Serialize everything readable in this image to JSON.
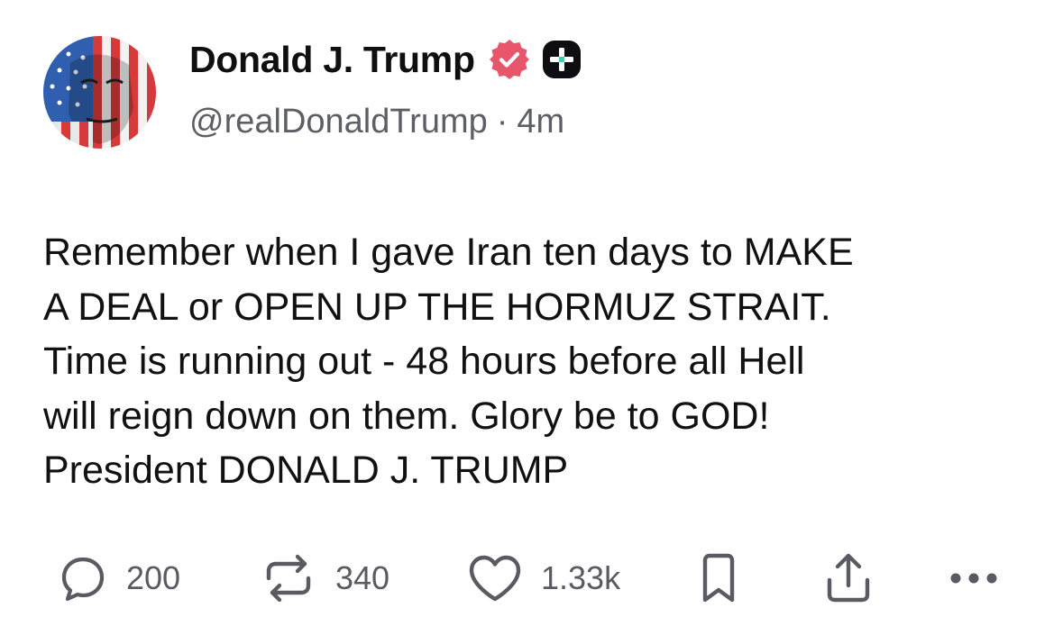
{
  "author": {
    "display_name": "Donald J. Trump",
    "handle": "@realDonaldTrump",
    "separator": "·",
    "time_ago": "4m",
    "verified_badge_color": "#e8566c",
    "plus_badge_color": "#0d0d12",
    "plus_badge_accent": "#3ad0b0"
  },
  "post": {
    "text": "Remember when I gave Iran ten days to MAKE\nA DEAL or OPEN UP THE HORMUZ STRAIT.\nTime is running out - 48 hours before all Hell\nwill reign down on them. Glory be to GOD!\nPresident DONALD J. TRUMP"
  },
  "actions": {
    "replies": "200",
    "reposts": "340",
    "likes": "1.33k",
    "icons": [
      "reply-icon",
      "repost-icon",
      "heart-icon",
      "bookmark-icon",
      "share-icon",
      "more-icon"
    ],
    "icon_color": "#5a5a62"
  }
}
